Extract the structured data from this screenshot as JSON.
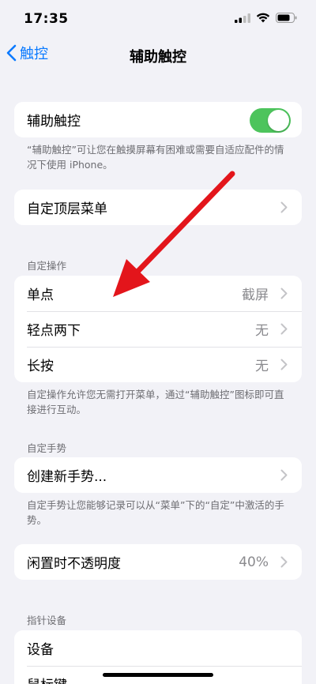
{
  "status": {
    "time": "17:35"
  },
  "nav": {
    "back_label": "触控",
    "title": "辅助触控"
  },
  "assistive": {
    "label": "辅助触控",
    "enabled": true,
    "footnote": "“辅助触控”可让您在触摸屏幕有困难或需要自适应配件的情况下使用 iPhone。"
  },
  "top_menu": {
    "label": "自定顶层菜单"
  },
  "custom_actions": {
    "header": "自定操作",
    "rows": [
      {
        "label": "单点",
        "value": "截屏"
      },
      {
        "label": "轻点两下",
        "value": "无"
      },
      {
        "label": "长按",
        "value": "无"
      }
    ],
    "footnote": "自定操作允许您无需打开菜单，通过“辅助触控”图标即可直接进行互动。"
  },
  "custom_gestures": {
    "header": "自定手势",
    "create_label": "创建新手势...",
    "footnote": "自定手势让您能够记录可以从“菜单”下的“自定”中激活的手势。"
  },
  "idle_opacity": {
    "label": "闲置时不透明度",
    "value": "40%"
  },
  "pointer_devices": {
    "header": "指针设备",
    "rows": [
      {
        "label": "设备"
      },
      {
        "label": "鼠标键"
      }
    ]
  },
  "colors": {
    "accent": "#0a7aff",
    "toggle_on": "#4dc45c",
    "annotation_arrow": "#e3151b"
  }
}
